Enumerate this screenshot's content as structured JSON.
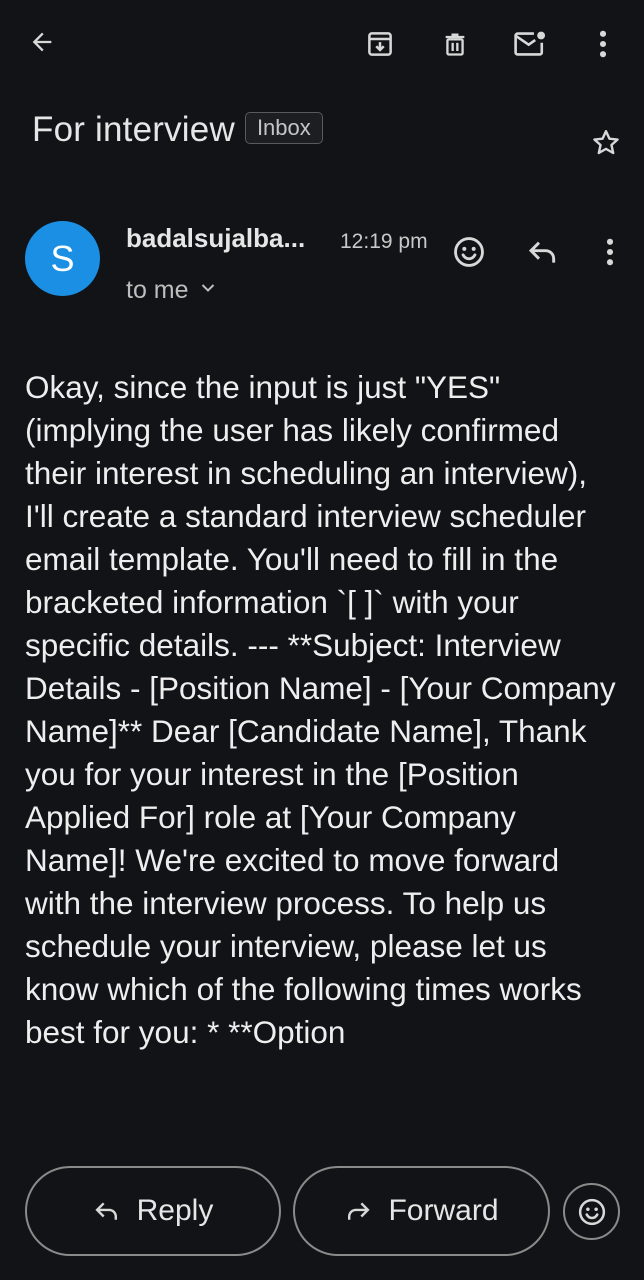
{
  "header": {
    "back_icon": "arrow-left-icon",
    "archive_icon": "archive-icon",
    "delete_icon": "trash-icon",
    "mark_unread_icon": "mail-unread-icon",
    "more_icon": "more-vertical-icon"
  },
  "subject": {
    "title": "For interview",
    "label": "Inbox",
    "star_icon": "star-outline-icon"
  },
  "message": {
    "avatar_letter": "S",
    "avatar_color": "#1a8fe3",
    "sender": "badalsujalba...",
    "time": "12:19 pm",
    "recipient": "to me",
    "body": "Okay, since the input is just \"YES\" (implying the user has likely confirmed their interest in scheduling an interview), I'll create a standard interview scheduler email template. You'll need to fill in the bracketed information `[ ]` with your specific details. --- **Subject: Interview Details - [Position Name] - [Your Company Name]** Dear [Candidate Name], Thank you for your interest in the [Position Applied For] role at [Your Company Name]! We're excited to move forward with the interview process. To help us schedule your interview, please let us know which of the following times works best for you: * **Option"
  },
  "actions": {
    "reply": "Reply",
    "forward": "Forward"
  }
}
